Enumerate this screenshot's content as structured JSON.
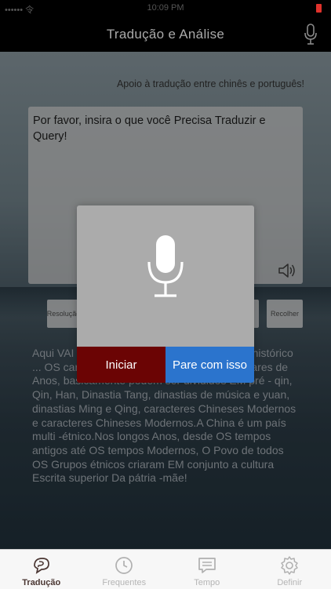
{
  "status_bar": {
    "carrier": "•••••• 令",
    "time": "10:09 PM"
  },
  "nav": {
    "title": "Tradução e Análise"
  },
  "support_text": "Apoio à tradução entre chinês e português!",
  "input": {
    "text": "Por favor, insira o que você Precisa Traduzir e Query!"
  },
  "buttons": {
    "resolve": "Resolução",
    "collect": "Recolher"
  },
  "content_text": "Aqui VAI ... caracteres Chineses ... processo histórico ... OS caracteres Chineses Ao Longo de milhares de Anos, basicamente podem ser divididos EM pré - qin, Qin, Han, Dinastia Tang, dinastias de música e yuan, dinastias Ming e Qing, caracteres Chineses Modernos e caracteres Chineses Modernos.A China é um país multi -étnico.Nos longos Anos, desde OS tempos antigos até OS tempos Modernos, O Povo de todos OS Grupos étnicos criaram EM conjunto a cultura Escrita superior Da pátria -mãe!",
  "modal": {
    "start_label": "Iniciar",
    "stop_label": "Pare com isso"
  },
  "tabs": [
    {
      "label": "Tradução",
      "icon": "translate-icon",
      "active": true
    },
    {
      "label": "Frequentes",
      "icon": "clock-icon",
      "active": false
    },
    {
      "label": "Tempo",
      "icon": "message-icon",
      "active": false
    },
    {
      "label": "Definir",
      "icon": "gear-icon",
      "active": false
    }
  ],
  "colors": {
    "start_button": "#6b0404",
    "stop_button": "#2b74cd",
    "active_tab": "#4a3632",
    "battery": "#e0322c"
  }
}
